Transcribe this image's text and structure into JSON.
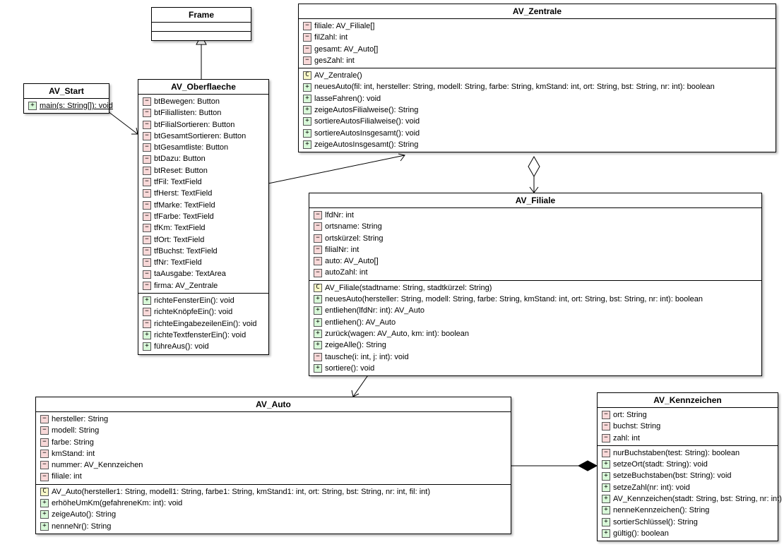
{
  "classes": {
    "frame": {
      "title": "Frame",
      "attributes": [],
      "methods": []
    },
    "av_start": {
      "title": "AV_Start",
      "attributes": [],
      "methods": [
        {
          "vis": "public",
          "text": "main(s: String[]): void",
          "static": true
        }
      ]
    },
    "av_oberflaeche": {
      "title": "AV_Oberflaeche",
      "attributes": [
        {
          "vis": "private",
          "text": "btBewegen: Button"
        },
        {
          "vis": "private",
          "text": "btFiliallisten: Button"
        },
        {
          "vis": "private",
          "text": "btFilialSortieren: Button"
        },
        {
          "vis": "private",
          "text": "btGesamtSortieren: Button"
        },
        {
          "vis": "private",
          "text": "btGesamtliste: Button"
        },
        {
          "vis": "private",
          "text": "btDazu: Button"
        },
        {
          "vis": "private",
          "text": "btReset: Button"
        },
        {
          "vis": "private",
          "text": "tfFil: TextField"
        },
        {
          "vis": "private",
          "text": "tfHerst: TextField"
        },
        {
          "vis": "private",
          "text": "tfMarke: TextField"
        },
        {
          "vis": "private",
          "text": "tfFarbe: TextField"
        },
        {
          "vis": "private",
          "text": "tfKm: TextField"
        },
        {
          "vis": "private",
          "text": "tfOrt: TextField"
        },
        {
          "vis": "private",
          "text": "tfBuchst: TextField"
        },
        {
          "vis": "private",
          "text": "tfNr: TextField"
        },
        {
          "vis": "private",
          "text": "taAusgabe: TextArea"
        },
        {
          "vis": "private",
          "text": "firma: AV_Zentrale"
        }
      ],
      "methods": [
        {
          "vis": "public",
          "text": "richteFensterEin(): void"
        },
        {
          "vis": "private",
          "text": "richteKnöpfeEin(): void"
        },
        {
          "vis": "private",
          "text": "richteEingabezeilenEin(): void"
        },
        {
          "vis": "public",
          "text": "richteTextfensterEin(): void"
        },
        {
          "vis": "public",
          "text": "führeAus(): void"
        }
      ]
    },
    "av_zentrale": {
      "title": "AV_Zentrale",
      "attributes": [
        {
          "vis": "private",
          "text": "filiale: AV_Filiale[]"
        },
        {
          "vis": "private",
          "text": "filZahl: int"
        },
        {
          "vis": "private",
          "text": "gesamt: AV_Auto[]"
        },
        {
          "vis": "private",
          "text": "gesZahl: int"
        }
      ],
      "methods": [
        {
          "vis": "constructor",
          "text": "AV_Zentrale()"
        },
        {
          "vis": "public",
          "text": "neuesAuto(fil: int, hersteller: String, modell: String, farbe: String, kmStand: int, ort: String, bst: String, nr: int): boolean"
        },
        {
          "vis": "public",
          "text": "lasseFahren(): void"
        },
        {
          "vis": "public",
          "text": "zeigeAutosFilialweise(): String"
        },
        {
          "vis": "public",
          "text": "sortiereAutosFilialweise(): void"
        },
        {
          "vis": "public",
          "text": "sortiereAutosInsgesamt(): void"
        },
        {
          "vis": "public",
          "text": "zeigeAutosInsgesamt(): String"
        }
      ]
    },
    "av_filiale": {
      "title": "AV_Filiale",
      "attributes": [
        {
          "vis": "private",
          "text": "lfdNr: int"
        },
        {
          "vis": "private",
          "text": "ortsname: String"
        },
        {
          "vis": "private",
          "text": "ortskürzel: String"
        },
        {
          "vis": "private",
          "text": "filialNr: int"
        },
        {
          "vis": "private",
          "text": "auto: AV_Auto[]"
        },
        {
          "vis": "private",
          "text": "autoZahl: int"
        }
      ],
      "methods": [
        {
          "vis": "constructor",
          "text": "AV_Filiale(stadtname: String, stadtkürzel: String)"
        },
        {
          "vis": "public",
          "text": "neuesAuto(hersteller: String, modell: String, farbe: String, kmStand: int, ort: String, bst: String, nr: int): boolean"
        },
        {
          "vis": "public",
          "text": "entliehen(lfdNr: int): AV_Auto"
        },
        {
          "vis": "public",
          "text": "entliehen(): AV_Auto"
        },
        {
          "vis": "public",
          "text": "zurück(wagen: AV_Auto, km: int): boolean"
        },
        {
          "vis": "public",
          "text": "zeigeAlle(): String"
        },
        {
          "vis": "private",
          "text": "tausche(i: int, j: int): void"
        },
        {
          "vis": "public",
          "text": "sortiere(): void"
        }
      ]
    },
    "av_auto": {
      "title": "AV_Auto",
      "attributes": [
        {
          "vis": "private",
          "text": "hersteller: String"
        },
        {
          "vis": "private",
          "text": "modell: String"
        },
        {
          "vis": "private",
          "text": "farbe: String"
        },
        {
          "vis": "private",
          "text": "kmStand: int"
        },
        {
          "vis": "private",
          "text": "nummer: AV_Kennzeichen"
        },
        {
          "vis": "private",
          "text": "filiale: int"
        }
      ],
      "methods": [
        {
          "vis": "constructor",
          "text": "AV_Auto(hersteller1: String, modell1: String, farbe1: String, kmStand1: int, ort: String, bst: String, nr: int, fil: int)"
        },
        {
          "vis": "public",
          "text": "erhöheUmKm(gefahreneKm: int): void"
        },
        {
          "vis": "public",
          "text": "zeigeAuto(): String"
        },
        {
          "vis": "public",
          "text": "nenneNr(): String"
        }
      ]
    },
    "av_kennzeichen": {
      "title": "AV_Kennzeichen",
      "attributes": [
        {
          "vis": "private",
          "text": "ort: String"
        },
        {
          "vis": "private",
          "text": "buchst: String"
        },
        {
          "vis": "private",
          "text": "zahl: int"
        }
      ],
      "methods": [
        {
          "vis": "private",
          "text": "nurBuchstaben(test: String): boolean"
        },
        {
          "vis": "public",
          "text": "setzeOrt(stadt: String): void"
        },
        {
          "vis": "public",
          "text": "setzeBuchstaben(bst: String): void"
        },
        {
          "vis": "public",
          "text": "setzeZahl(nr: int): void"
        },
        {
          "vis": "public",
          "text": "AV_Kennzeichen(stadt: String, bst: String, nr: int)"
        },
        {
          "vis": "public",
          "text": "nenneKennzeichen(): String"
        },
        {
          "vis": "public",
          "text": "sortierSchlüssel(): String"
        },
        {
          "vis": "public",
          "text": "gültig(): boolean"
        }
      ]
    }
  }
}
